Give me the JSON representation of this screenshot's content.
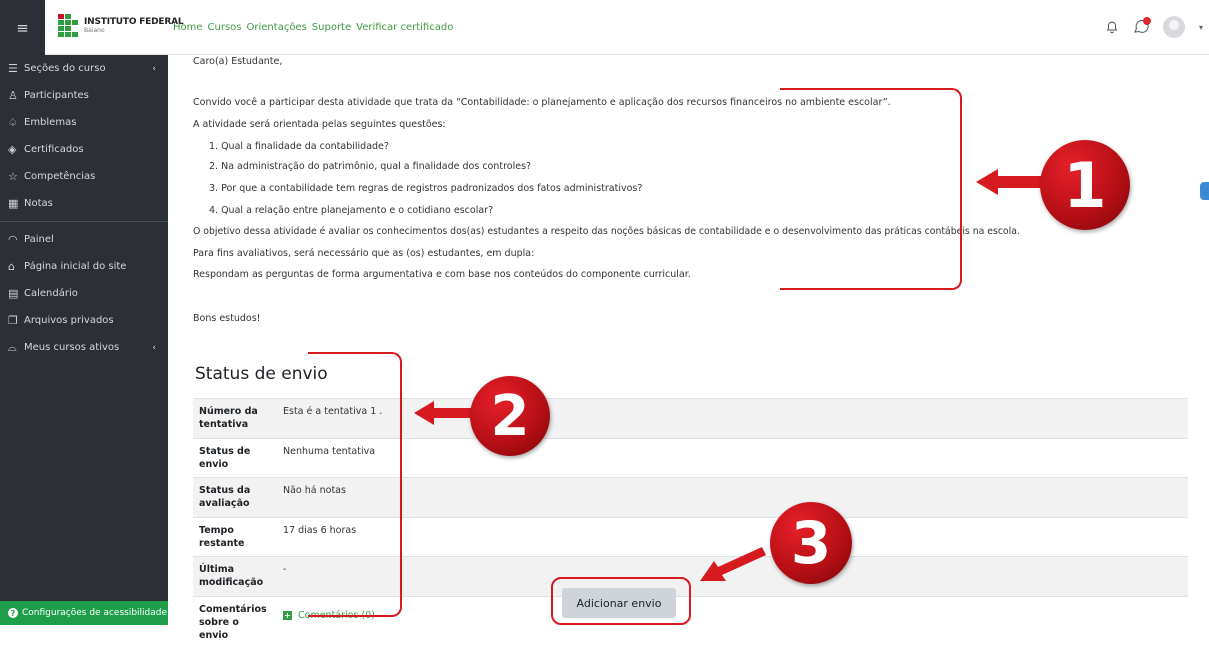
{
  "header": {
    "logo_name": "INSTITUTO FEDERAL",
    "logo_sub": "Baiano",
    "nav": [
      "Home",
      "Cursos",
      "Orientações",
      "Suporte",
      "Verificar certificado"
    ]
  },
  "sidebar": {
    "items": [
      {
        "label": "Seções do curso",
        "icon": "list-icon",
        "glyph": "☰",
        "chevron": "‹"
      },
      {
        "label": "Participantes",
        "icon": "users-icon",
        "glyph": "♙"
      },
      {
        "label": "Emblemas",
        "icon": "badge-icon",
        "glyph": "♤"
      },
      {
        "label": "Certificados",
        "icon": "certificate-icon",
        "glyph": "◈"
      },
      {
        "label": "Competências",
        "icon": "star-icon",
        "glyph": "☆"
      },
      {
        "label": "Notas",
        "icon": "grades-icon",
        "glyph": "▦"
      },
      {
        "label": "Painel",
        "icon": "dashboard-icon",
        "glyph": "◠"
      },
      {
        "label": "Página inicial do site",
        "icon": "home-icon",
        "glyph": "⌂"
      },
      {
        "label": "Calendário",
        "icon": "calendar-icon",
        "glyph": "▤"
      },
      {
        "label": "Arquivos privados",
        "icon": "files-icon",
        "glyph": "❐"
      },
      {
        "label": "Meus cursos ativos",
        "icon": "graduation-icon",
        "glyph": "⌓",
        "chevron": "‹"
      }
    ],
    "accessibility": "Configurações de acessibilidade"
  },
  "content": {
    "greeting": "Caro(a) Estudante,",
    "intro": "Convido você a participar desta atividade que trata da “Contabilidade: o planejamento e aplicação dos recursos financeiros no ambiente escolar”.",
    "guiding": "A atividade será orientada pelas seguintes questões:",
    "questions": [
      "1. Qual a finalidade da contabilidade?",
      "2. Na administração do patrimônio, qual a finalidade dos controles?",
      "3. Por que a contabilidade tem regras de registros padronizados dos fatos administrativos?",
      "4. Qual a relação entre planejamento e o cotidiano escolar?"
    ],
    "objective": "O objetivo dessa atividade é avaliar os conhecimentos dos(as) estudantes a respeito das noções básicas de contabilidade e o desenvolvimento das práticas contábeis na escola.",
    "evaluation": "Para fins avaliativos, será necessário que as (os) estudantes, em dupla:",
    "instruction": "Respondam as perguntas de forma argumentativa e com base nos conteúdos do componente curricular.",
    "closing": "Bons estudos!"
  },
  "status": {
    "title": "Status de envio",
    "rows": [
      {
        "label": "Número da tentativa",
        "value": "Esta é a tentativa 1 ."
      },
      {
        "label": "Status de envio",
        "value": "Nenhuma tentativa"
      },
      {
        "label": "Status da avaliação",
        "value": "Não há notas"
      },
      {
        "label": "Tempo restante",
        "value": "17 dias 6 horas"
      },
      {
        "label": "Última modificação",
        "value": "-"
      },
      {
        "label": "Comentários sobre o envio",
        "value": "Comentários (0)"
      }
    ],
    "button": "Adicionar envio"
  },
  "annotations": {
    "numbers": [
      "1",
      "2",
      "3"
    ],
    "color": "#d71920"
  }
}
